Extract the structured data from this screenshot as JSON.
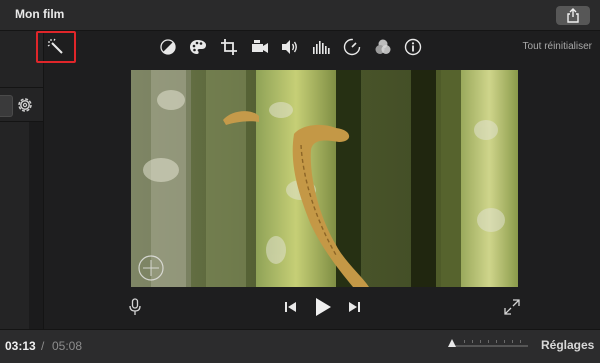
{
  "window": {
    "title": "Mon film",
    "share_icon": "share-icon"
  },
  "sidebar": {
    "settings_icon": "gear-icon"
  },
  "toolbar": {
    "magic_icon": "magic-wand-icon",
    "tools": [
      "color-balance-icon",
      "color-correction-icon",
      "crop-icon",
      "stabilization-icon",
      "volume-icon",
      "equalizer-icon",
      "speed-icon",
      "filters-icon",
      "info-icon"
    ],
    "reset_label": "Tout réinitialiser",
    "highlight_color": "#e0262a"
  },
  "viewer": {
    "microphone_icon": "microphone-icon",
    "previous_icon": "skip-back-icon",
    "play_icon": "play-icon",
    "next_icon": "skip-forward-icon",
    "fullscreen_icon": "fullscreen-icon"
  },
  "timeline": {
    "current_time": "03:13",
    "separator": "/",
    "total_time": "05:08",
    "settings_label": "Réglages"
  }
}
